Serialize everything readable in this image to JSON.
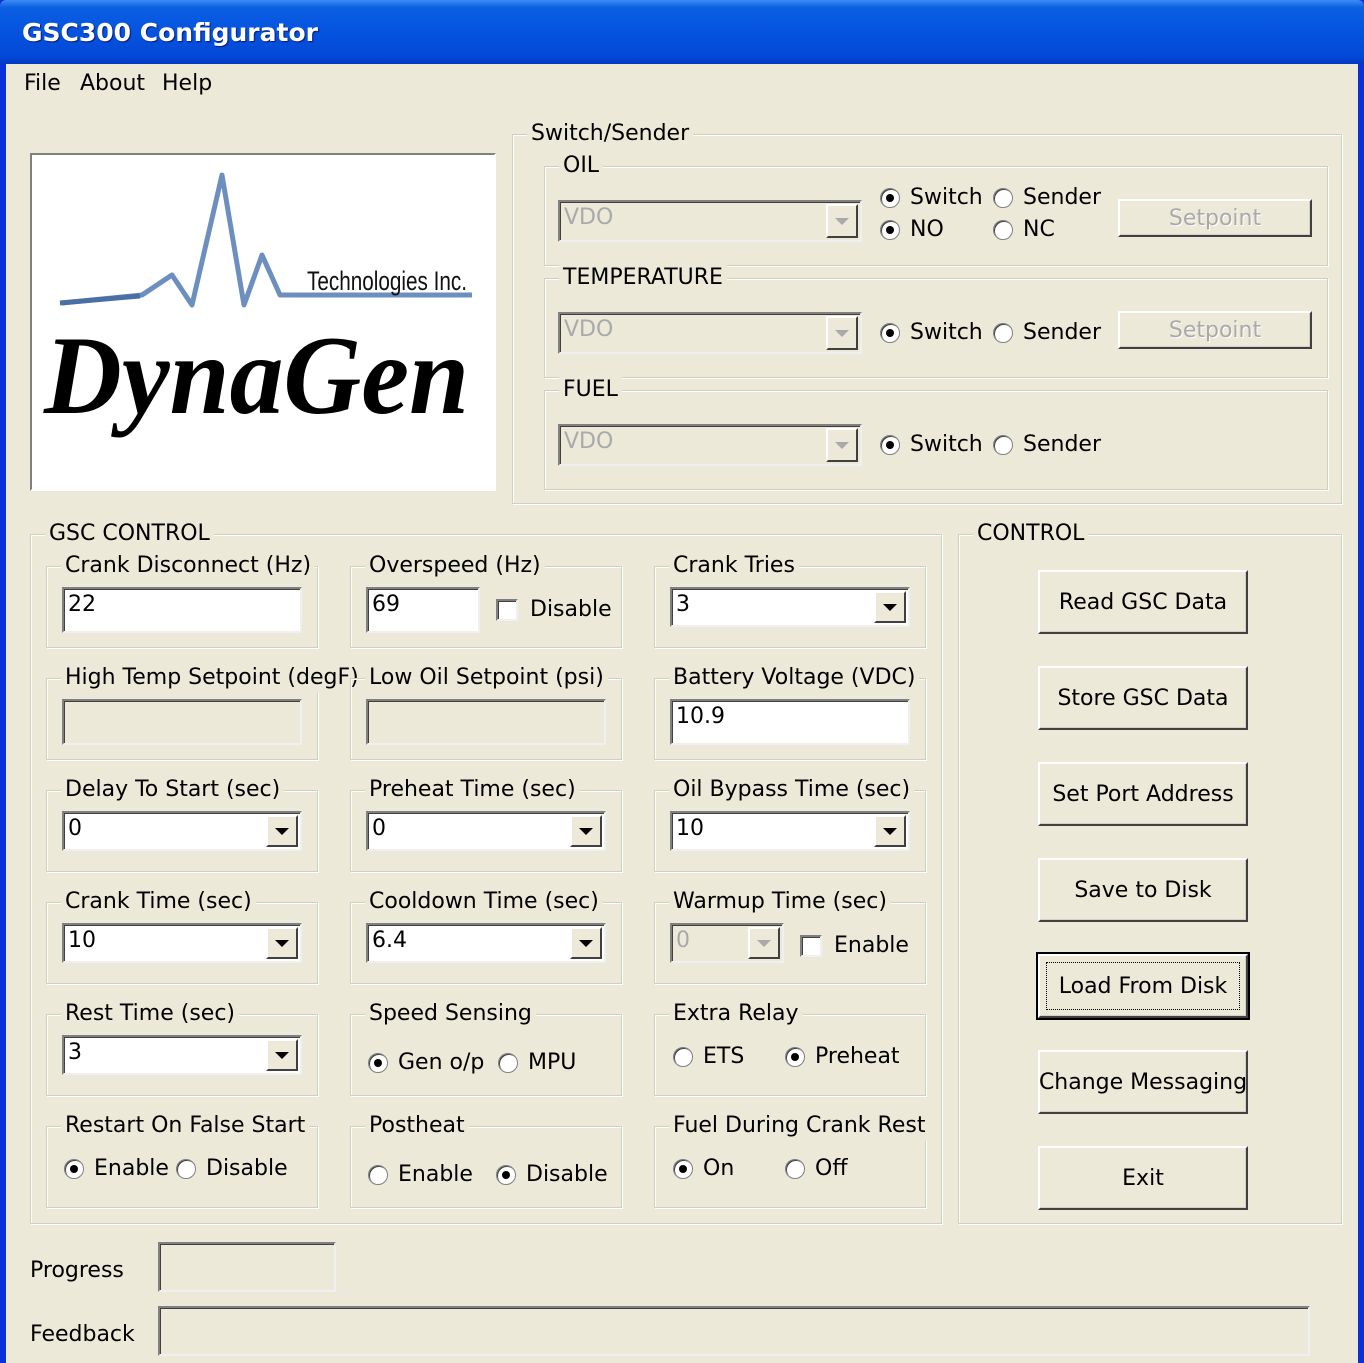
{
  "window": {
    "title": "GSC300 Configurator"
  },
  "menu": {
    "items": [
      "File",
      "About",
      "Help"
    ]
  },
  "logo": {
    "company": "Technologies Inc.",
    "brand": "DynaGen"
  },
  "switch_sender": {
    "title": "Switch/Sender",
    "oil": {
      "title": "OIL",
      "combo": "VDO",
      "opt_switch": "Switch",
      "opt_sender": "Sender",
      "opt_no": "NO",
      "opt_nc": "NC",
      "setpoint": "Setpoint"
    },
    "temperature": {
      "title": "TEMPERATURE",
      "combo": "VDO",
      "opt_switch": "Switch",
      "opt_sender": "Sender",
      "setpoint": "Setpoint"
    },
    "fuel": {
      "title": "FUEL",
      "combo": "VDO",
      "opt_switch": "Switch",
      "opt_sender": "Sender"
    }
  },
  "gsc_control": {
    "title": "GSC CONTROL",
    "crank_disconnect": {
      "label": "Crank Disconnect (Hz)",
      "value": "22"
    },
    "overspeed": {
      "label": "Overspeed (Hz)",
      "value": "69",
      "disable": "Disable"
    },
    "crank_tries": {
      "label": "Crank Tries",
      "value": "3"
    },
    "high_temp": {
      "label": "High Temp Setpoint (degF)",
      "value": ""
    },
    "low_oil": {
      "label": "Low Oil Setpoint (psi)",
      "value": ""
    },
    "battery": {
      "label": "Battery Voltage (VDC)",
      "value": "10.9"
    },
    "delay_start": {
      "label": "Delay To Start (sec)",
      "value": "0"
    },
    "preheat_time": {
      "label": "Preheat Time (sec)",
      "value": "0"
    },
    "oil_bypass": {
      "label": "Oil Bypass Time (sec)",
      "value": "10"
    },
    "crank_time": {
      "label": "Crank Time (sec)",
      "value": "10"
    },
    "cooldown": {
      "label": "Cooldown Time (sec)",
      "value": "6.4"
    },
    "warmup": {
      "label": "Warmup Time (sec)",
      "value": "0",
      "enable": "Enable"
    },
    "rest_time": {
      "label": "Rest Time (sec)",
      "value": "3"
    },
    "speed_sensing": {
      "label": "Speed Sensing",
      "opt1": "Gen o/p",
      "opt2": "MPU"
    },
    "extra_relay": {
      "label": "Extra Relay",
      "opt1": "ETS",
      "opt2": "Preheat"
    },
    "restart": {
      "label": "Restart On False Start",
      "opt1": "Enable",
      "opt2": "Disable"
    },
    "postheat": {
      "label": "Postheat",
      "opt1": "Enable",
      "opt2": "Disable"
    },
    "fuel_crank": {
      "label": "Fuel During Crank Rest",
      "opt1": "On",
      "opt2": "Off"
    }
  },
  "control": {
    "title": "CONTROL",
    "buttons": [
      "Read GSC Data",
      "Store GSC Data",
      "Set Port Address",
      "Save to Disk",
      "Load From Disk",
      "Change Messaging",
      "Exit"
    ]
  },
  "status": {
    "progress_label": "Progress",
    "feedback_label": "Feedback"
  },
  "colors": {
    "title_bar": "#0553e0",
    "face": "#ece9d8"
  }
}
